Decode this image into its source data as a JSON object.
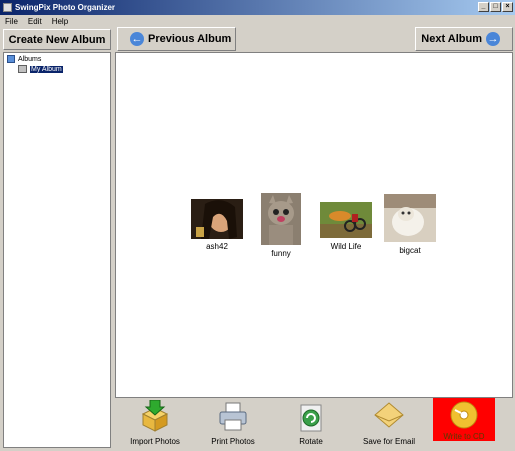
{
  "window": {
    "title": "SwingPix Photo Organizer"
  },
  "menu": [
    "File",
    "Edit",
    "Help"
  ],
  "buttons": {
    "create_album": "Create New Album",
    "previous_album": "Previous Album",
    "next_album": "Next Album"
  },
  "tree": {
    "root": "Albums",
    "child": "My Album"
  },
  "photos": [
    {
      "caption": "ash42",
      "icon": "portrait-photo-icon"
    },
    {
      "caption": "funny",
      "icon": "cat-photo-icon"
    },
    {
      "caption": "Wild Life",
      "icon": "wildlife-photo-icon"
    },
    {
      "caption": "bigcat",
      "icon": "white-cat-photo-icon"
    }
  ],
  "toolbar": {
    "import": "Import Photos",
    "print": "Print Photos",
    "rotate": "Rotate",
    "email": "Save for Email",
    "cd": "Write to CD"
  },
  "colors": {
    "title_start": "#0a246a",
    "title_end": "#a6caf0",
    "cd_bg": "#ff0000",
    "selection": "#0a246a"
  }
}
